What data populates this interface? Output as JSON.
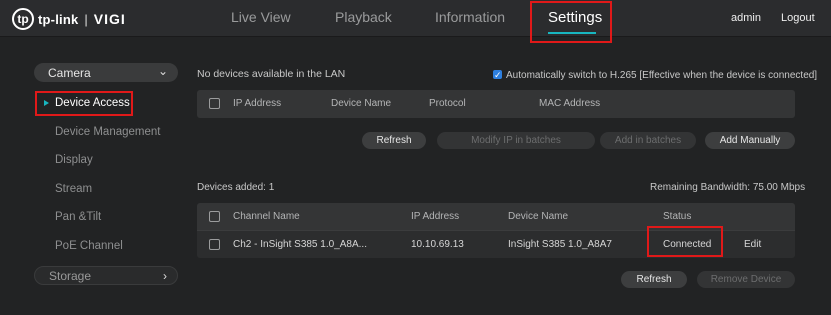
{
  "brand": {
    "mark": "tp",
    "name": "tp-link",
    "separator": "|",
    "product": "VIGI"
  },
  "nav": {
    "live_view": "Live View",
    "playback": "Playback",
    "information": "Information",
    "settings": "Settings"
  },
  "user": {
    "name": "admin",
    "logout": "Logout"
  },
  "sidebar": {
    "camera": "Camera",
    "items": [
      "Device Access",
      "Device Management",
      "Display",
      "Stream",
      "Pan &Tilt",
      "PoE Channel"
    ],
    "storage": "Storage"
  },
  "lan": {
    "message": "No devices available in the LAN",
    "auto_switch": "Automatically switch to H.265 [Effective when the device is connected]",
    "auto_switch_checked": true,
    "columns": [
      "IP Address",
      "Device Name",
      "Protocol",
      "MAC Address"
    ]
  },
  "lan_buttons": {
    "refresh": "Refresh",
    "modify_ip": "Modify IP in batches",
    "add_batches": "Add in batches",
    "add_manually": "Add Manually"
  },
  "added": {
    "label": "Devices added: 1",
    "bandwidth": "Remaining Bandwidth: 75.00 Mbps",
    "columns": [
      "Channel Name",
      "IP Address",
      "Device Name",
      "Status"
    ],
    "rows": [
      {
        "channel": "Ch2 - InSight S385 1.0_A8A...",
        "ip": "10.10.69.13",
        "device": "InSight S385 1.0_A8A7",
        "status": "Connected",
        "action": "Edit"
      }
    ]
  },
  "added_buttons": {
    "refresh": "Refresh",
    "remove": "Remove Device"
  },
  "colors": {
    "accent": "#18b6c0",
    "highlight": "#e01919",
    "checkbox": "#2d7fe0"
  }
}
